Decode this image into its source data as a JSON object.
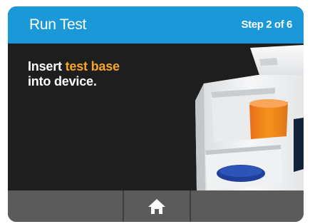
{
  "header": {
    "title": "Run Test",
    "step": "Step 2 of 6"
  },
  "instruction": {
    "line1_prefix": "Insert ",
    "line1_highlight": "test base",
    "line2": "into device."
  },
  "footer": {
    "home_icon": "home-icon"
  },
  "colors": {
    "header": "#1b98d8",
    "background": "#1f1e1e",
    "highlight": "#f5a623",
    "footer": "#5b5b5b"
  }
}
